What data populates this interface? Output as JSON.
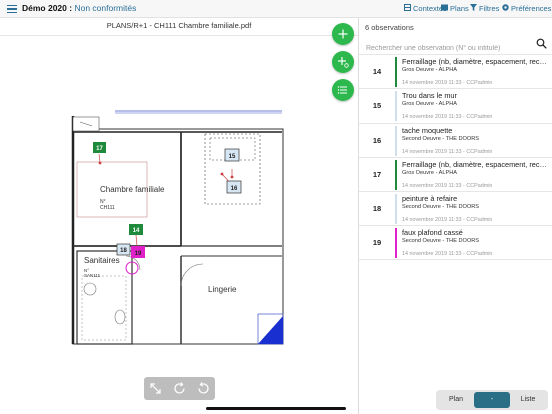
{
  "header": {
    "app_title": "Démo 2020 :",
    "subtitle": "Non conformités",
    "actions": [
      {
        "label": "Contextes",
        "icon": "context-icon"
      },
      {
        "label": "Plans",
        "icon": "plans-icon"
      },
      {
        "label": "Filtres",
        "icon": "filter-icon"
      },
      {
        "label": "Préférences",
        "icon": "preferences-icon"
      }
    ]
  },
  "plan": {
    "file_name": "PLANS/R+1 - CH111 Chambre familiale.pdf",
    "room_labels": {
      "chambre": "Chambre familiale",
      "chambre_no": "N°",
      "chambre_code": "CH111",
      "sanitaires": "Sanitaires",
      "sanitaires_no": "N°",
      "sanitaires_code": "SAN111",
      "lingerie": "Lingerie"
    },
    "markers": [
      {
        "num": "17",
        "color": "#1f8a3b"
      },
      {
        "num": "15",
        "color": "#d6e6f2"
      },
      {
        "num": "16",
        "color": "#d6e6f2"
      },
      {
        "num": "14",
        "color": "#1f8a3b"
      },
      {
        "num": "18",
        "color": "#d6e6f2"
      },
      {
        "num": "19",
        "color": "#e020c8"
      }
    ]
  },
  "fabs": [
    {
      "name": "add-observation-button",
      "icon": "plus-icon"
    },
    {
      "name": "add-multiple-button",
      "icon": "plus-count-icon"
    },
    {
      "name": "list-view-button",
      "icon": "list-icon"
    }
  ],
  "tools": [
    "resize-icon",
    "rotate-right-icon",
    "rotate-left-icon"
  ],
  "list": {
    "count_label": "6 observations",
    "search_placeholder": "Rechercher une observation (N° ou intitulé)",
    "items": [
      {
        "num": "14",
        "title": "Ferraillage (nb, diamètre, espacement, recouvrement…",
        "category": "Gros Oeuvre - ALPHA",
        "date": "14 novembre 2019 11:33 - CCPadmin",
        "color": "#1f8a3b"
      },
      {
        "num": "15",
        "title": "Trou dans le mur",
        "category": "Gros Oeuvre - ALPHA",
        "date": "14 novembre 2019 11:33 - CCPadmin",
        "color": "#cfe0ec"
      },
      {
        "num": "16",
        "title": "tache moquette",
        "category": "Second Oeuvre - THE DOORS",
        "date": "14 novembre 2019 11:33 - CCPadmin",
        "color": "#cfe0ec"
      },
      {
        "num": "17",
        "title": "Ferraillage (nb, diamètre, espacement, recouvrement…",
        "category": "Gros Oeuvre - ALPHA",
        "date": "14 novembre 2019 11:33 - CCPadmin",
        "color": "#1f8a3b"
      },
      {
        "num": "18",
        "title": "peinture à refaire",
        "category": "Second Oeuvre - THE DOORS",
        "date": "14 novembre 2019 11:33 - CCPadmin",
        "color": "#cfe0ec"
      },
      {
        "num": "19",
        "title": "faux plafond cassé",
        "category": "Second Oeuvre - THE DOORS",
        "date": "14 novembre 2019 11:33 - CCPadmin",
        "color": "#e020c8"
      }
    ]
  },
  "segment": {
    "plan": "Plan",
    "both": "-",
    "list": "Liste",
    "selected": "both"
  },
  "colors": {
    "accent": "#2a6f97",
    "fab": "#2db84d",
    "segment_selected": "#2a6f86"
  }
}
